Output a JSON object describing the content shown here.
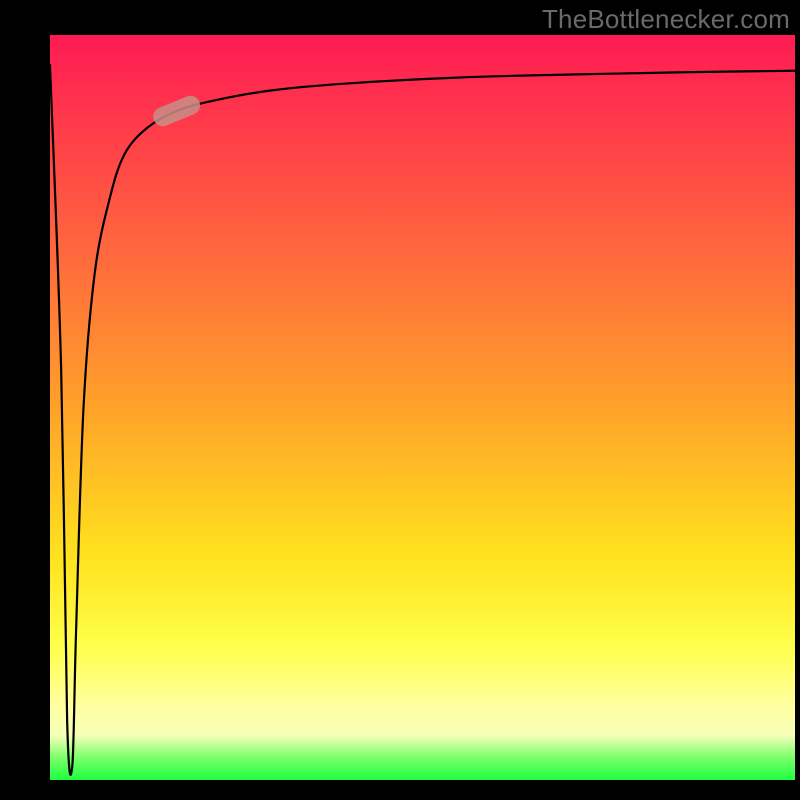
{
  "attribution": "TheBottlenecker.com",
  "chart_data": {
    "type": "line",
    "title": "",
    "xlabel": "",
    "ylabel": "",
    "xlim": [
      0,
      100
    ],
    "ylim": [
      0,
      100
    ],
    "series": [
      {
        "name": "bottleneck-curve",
        "x": [
          0,
          1.5,
          2.3,
          3,
          3.5,
          4.5,
          6,
          8,
          10,
          13,
          17,
          22,
          30,
          40,
          55,
          70,
          85,
          100
        ],
        "y": [
          96,
          55,
          8,
          2,
          20,
          50,
          68,
          78,
          84,
          87.5,
          89.8,
          91.2,
          92.6,
          93.5,
          94.3,
          94.7,
          95,
          95.2
        ]
      }
    ],
    "marker": {
      "x_pct": 17,
      "y_pct": 89.8,
      "label": "highlighted-point"
    },
    "background_gradient": {
      "stops": [
        {
          "pct": 0,
          "color": "#ff1a54"
        },
        {
          "pct": 50,
          "color": "#ffa229"
        },
        {
          "pct": 82,
          "color": "#ffff4a"
        },
        {
          "pct": 97,
          "color": "#7bff6b"
        },
        {
          "pct": 100,
          "color": "#1dff3d"
        }
      ]
    }
  }
}
